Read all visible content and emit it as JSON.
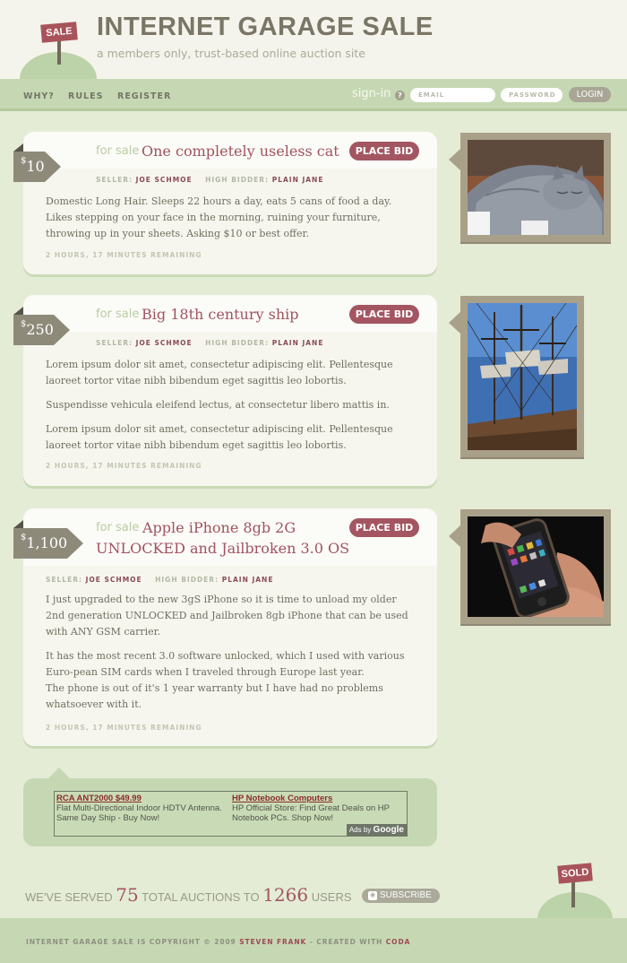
{
  "header": {
    "sign_label": "SALE",
    "title": "INTERNET GARAGE SALE",
    "tagline": "a members only, trust-based online auction site"
  },
  "nav": {
    "links": [
      "WHY?",
      "RULES",
      "REGISTER"
    ],
    "signin_label": "sign-in",
    "help_icon": "?",
    "email_placeholder": "EMAIL",
    "password_placeholder": "PASSWORD",
    "login_label": "LOGIN"
  },
  "listings": [
    {
      "currency": "$",
      "price": "10",
      "status": "for sale",
      "title_lines": [
        "One completely useless cat"
      ],
      "bid_label": "PLACE BID",
      "seller_label": "SELLER:",
      "seller": "JOE SCHMOE",
      "bidder_label": "HIGH BIDDER:",
      "bidder": "PLAIN JANE",
      "paragraphs": [
        "Domestic Long Hair. Sleeps 22 hours a day, eats 5 cans of food a day. Likes stepping on your face in the morning, ruining your furniture, throwing up in your sheets. Asking $10 or best offer."
      ],
      "remaining": "2 HOURS, 17 MINUTES REMAINING",
      "photo": "cat"
    },
    {
      "currency": "$",
      "price": "250",
      "status": "for sale",
      "title_lines": [
        "Big 18th century ship"
      ],
      "bid_label": "PLACE BID",
      "seller_label": "SELLER:",
      "seller": "JOE SCHMOE",
      "bidder_label": "HIGH BIDDER:",
      "bidder": "PLAIN JANE",
      "paragraphs": [
        "Lorem ipsum dolor sit amet, consectetur adipiscing elit. Pellentesque laoreet tortor vitae nibh bibendum eget sagittis leo lobortis.",
        "Suspendisse vehicula eleifend lectus, at consectetur libero mattis in.",
        "Lorem ipsum dolor sit amet, consectetur adipiscing elit. Pellentesque laoreet tortor vitae nibh bibendum eget sagittis leo lobortis."
      ],
      "remaining": "2 HOURS, 17 MINUTES REMAINING",
      "photo": "ship"
    },
    {
      "currency": "$",
      "price": "1,100",
      "status": "for sale",
      "title_lines": [
        "Apple iPhone 8gb 2G",
        "UNLOCKED and Jailbroken 3.0 OS"
      ],
      "bid_label": "PLACE BID",
      "seller_label": "SELLER:",
      "seller": "JOE SCHMOE",
      "bidder_label": "HIGH BIDDER:",
      "bidder": "PLAIN JANE",
      "paragraphs": [
        "I just upgraded to the new 3gS iPhone so it is time to unload my older 2nd generation UNLOCKED and Jailbroken 8gb iPhone that can be used with ANY GSM carrier.",
        "It has the most recent 3.0 software unlocked, which I used with various Euro-pean SIM cards when I traveled through Europe last year.",
        "The phone is out of it's 1 year warranty but I have had no problems whatsoever with it."
      ],
      "remaining": "2 HOURS, 17 MINUTES REMAINING",
      "photo": "phone"
    }
  ],
  "ads": {
    "items": [
      {
        "title": "RCA ANT2000 $49.99",
        "text": "Flat Multi-Directional Indoor HDTV Antenna. Same Day Ship - Buy Now!"
      },
      {
        "title": "HP Notebook Computers",
        "text": "HP Official Store: Find Great Deals on HP Notebook PCs. Shop Now!"
      }
    ],
    "ads_by": "Ads by",
    "google": "Google"
  },
  "stats": {
    "prefix": "WE'VE SERVED",
    "auctions": "75",
    "middle": "TOTAL AUCTIONS TO",
    "users": "1266",
    "suffix": "USERS"
  },
  "subscribe_label": "SUBSCRIBE",
  "sold_label": "SOLD",
  "footer": {
    "prefix": "INTERNET GARAGE SALE IS COPYRIGHT © 2009",
    "author": "STEVEN FRANK",
    "middle": "- CREATED WITH",
    "tool": "CODA"
  },
  "colors": {
    "background": "#e4ecd6",
    "bar": "#c6d8b3",
    "accent": "#a35661",
    "tag": "#8e8a7a"
  }
}
